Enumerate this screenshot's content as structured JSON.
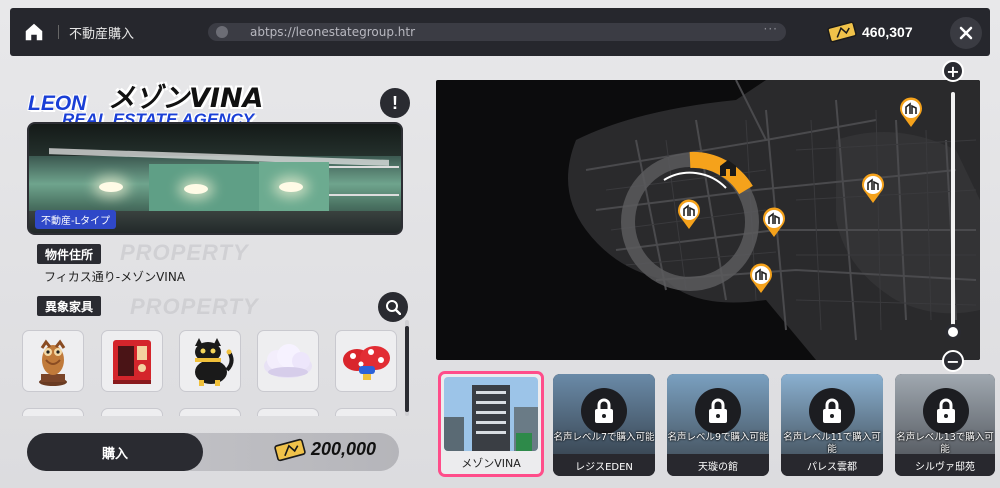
{
  "topbar": {
    "breadcrumb": "不動産購入",
    "url": "abtps://leonestategroup.htr",
    "url_more": "···",
    "currency": "460,307"
  },
  "logo": {
    "leon": "LEON",
    "agency": "REAL ESTATE AGENCY"
  },
  "property": {
    "title": "メゾンVINA",
    "type_tag": "不動産-Lタイプ",
    "address_label": "物件住所",
    "address_ghost": "PROPERTY",
    "address": "フィカス通り-メゾンVINA",
    "furniture_label": "異象家具",
    "furniture_ghost": "PROPERTY"
  },
  "furniture": [
    {
      "icon": "owl-statue-icon"
    },
    {
      "icon": "red-phone-booth-icon"
    },
    {
      "icon": "black-cat-figure-icon"
    },
    {
      "icon": "cloud-cushion-icon"
    },
    {
      "icon": "red-mushroom-icon"
    }
  ],
  "purchase": {
    "buy_label": "購入",
    "price": "200,000"
  },
  "map": {
    "zoom_in": "+",
    "zoom_out": "−",
    "zoom_level": 0.05
  },
  "cards": [
    {
      "name": "メゾンVINA",
      "locked": false,
      "lock_text": ""
    },
    {
      "name": "レジスEDEN",
      "locked": true,
      "lock_text": "名声レベル7で購入可能"
    },
    {
      "name": "天璇の館",
      "locked": true,
      "lock_text": "名声レベル9で購入可能"
    },
    {
      "name": "パレス雲都",
      "locked": true,
      "lock_text": "名声レベル11で購入可能"
    },
    {
      "name": "シルヴァ邸苑",
      "locked": true,
      "lock_text": "名声レベル13で購入可能"
    }
  ],
  "colors": {
    "accent_orange": "#f5a21b",
    "selected_border": "#ff4d8a",
    "logo_blue": "#1a3fd6",
    "dark": "#2a2b31"
  }
}
